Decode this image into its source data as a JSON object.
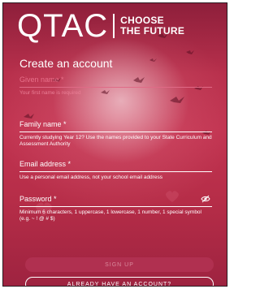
{
  "logo": {
    "wordmark": "QTAC",
    "tagline_line1": "CHOOSE",
    "tagline_line2": "THE FUTURE"
  },
  "form": {
    "title": "Create an account",
    "given_name": {
      "label": "Given name *",
      "error": "Your first name is required"
    },
    "family_name": {
      "label": "Family name *",
      "help": "Currently studying Year 12? Use the names provided to your State Curriculum and Assessment Authority"
    },
    "email": {
      "label": "Email address *",
      "help": "Use a personal email address, not your school email address"
    },
    "password": {
      "label": "Password *",
      "help": "Minimum 6 characters, 1 uppercase, 1 lowercase, 1 number, 1 special symbol (e.g. ~ ! @ # $)"
    }
  },
  "buttons": {
    "sign_up": "SIGN UP",
    "login": "ALREADY HAVE AN ACCOUNT?"
  },
  "colors": {
    "background": "#b8304c",
    "error": "#e8708a"
  }
}
